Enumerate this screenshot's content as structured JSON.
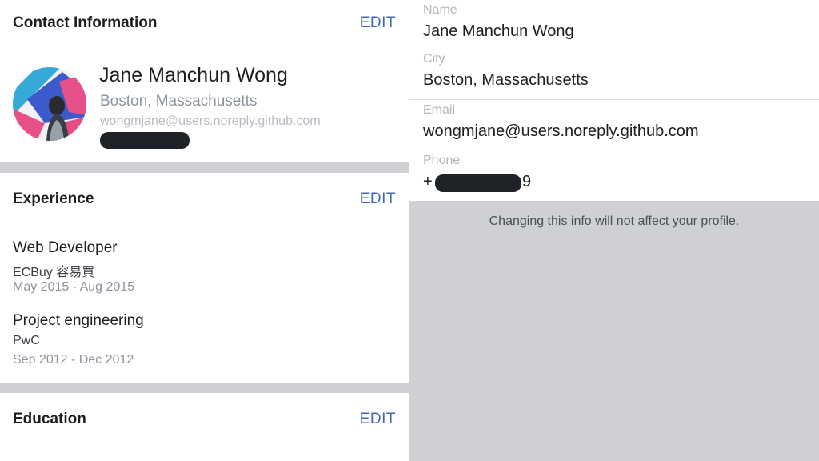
{
  "contact": {
    "title": "Contact Information",
    "edit_label": "EDIT",
    "name": "Jane Manchun Wong",
    "location": "Boston, Massachusetts",
    "email": "wongmjane@users.noreply.github.com"
  },
  "experience": {
    "title": "Experience",
    "edit_label": "EDIT",
    "jobs": [
      {
        "title": "Web Developer",
        "company": "ECBuy 容易買",
        "dates": "May 2015 - Aug 2015"
      },
      {
        "title": "Project engineering",
        "company": "PwC",
        "dates": "Sep 2012 - Dec 2012"
      }
    ]
  },
  "education": {
    "title": "Education",
    "edit_label": "EDIT"
  },
  "form": {
    "fields": [
      {
        "label": "Name",
        "value": "Jane Manchun Wong"
      },
      {
        "label": "City",
        "value": "Boston, Massachusetts"
      },
      {
        "label": "Email",
        "value": "wongmjane@users.noreply.github.com"
      },
      {
        "label": "Phone",
        "prefix": "+",
        "suffix": "9"
      }
    ],
    "note": "Changing this info will not affect your profile."
  },
  "colors": {
    "accent": "#4267b2",
    "divider": "#cfd0d4",
    "avatar_pink": "#e8508a",
    "avatar_blue": "#3b5bcc",
    "avatar_cyan": "#36a9d6"
  },
  "icons": {
    "avatar": "profile-photo"
  }
}
